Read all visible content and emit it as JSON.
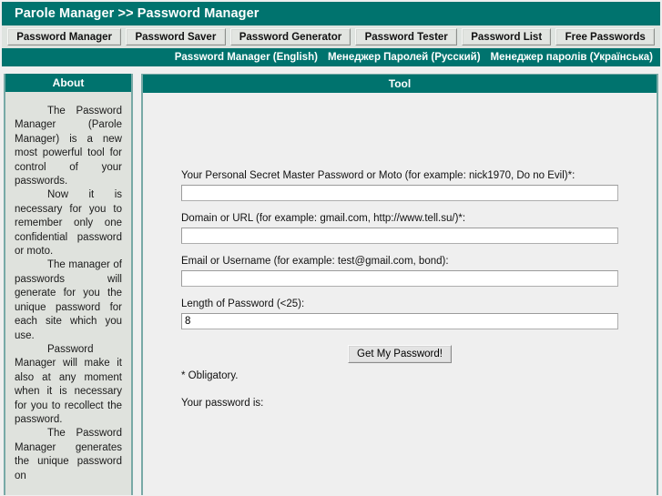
{
  "header": {
    "title": "Parole Manager >> Password Manager"
  },
  "nav": {
    "buttons": [
      {
        "label": "Password Manager"
      },
      {
        "label": "Password Saver"
      },
      {
        "label": "Password Generator"
      },
      {
        "label": "Password Tester"
      },
      {
        "label": "Password List"
      },
      {
        "label": "Free Passwords"
      }
    ]
  },
  "languages": [
    {
      "label": "Password Manager (English)"
    },
    {
      "label": "Менеджер Паролей (Русский)"
    },
    {
      "label": "Менеджер паролів (Українська)"
    }
  ],
  "sidebar": {
    "heading": "About",
    "paragraphs": [
      "The Password Manager (Parole Manager) is a new most powerful tool for control of your passwords.",
      "Now it is necessary for you to remember only one confidential password or moto.",
      "The manager of passwords will generate for you the unique password for each site which you use.",
      "Password Manager will make it also at any moment when it is necessary for you to recollect the password.",
      "The Password Manager generates the unique password on"
    ]
  },
  "main": {
    "heading": "Tool",
    "fields": [
      {
        "label": "Your Personal Secret Master Password or Moto (for example: nick1970, Do no Evil)*:",
        "value": "",
        "name": "master-password-input"
      },
      {
        "label": "Domain or URL (for example: gmail.com, http://www.tell.su/)*:",
        "value": "",
        "name": "domain-url-input"
      },
      {
        "label": "Email or Username (for example: test@gmail.com, bond):",
        "value": "",
        "name": "email-username-input"
      },
      {
        "label": "Length of Password (<25):",
        "value": "8",
        "name": "password-length-input"
      }
    ],
    "submit_label": "Get My Password!",
    "obligatory_note": "* Obligatory.",
    "result_label": "Your password is:"
  },
  "colors": {
    "teal": "#00736e",
    "panel_bg": "#efefef",
    "sidebar_bg": "#dfe2dd",
    "border_teal": "#78a9a6"
  }
}
